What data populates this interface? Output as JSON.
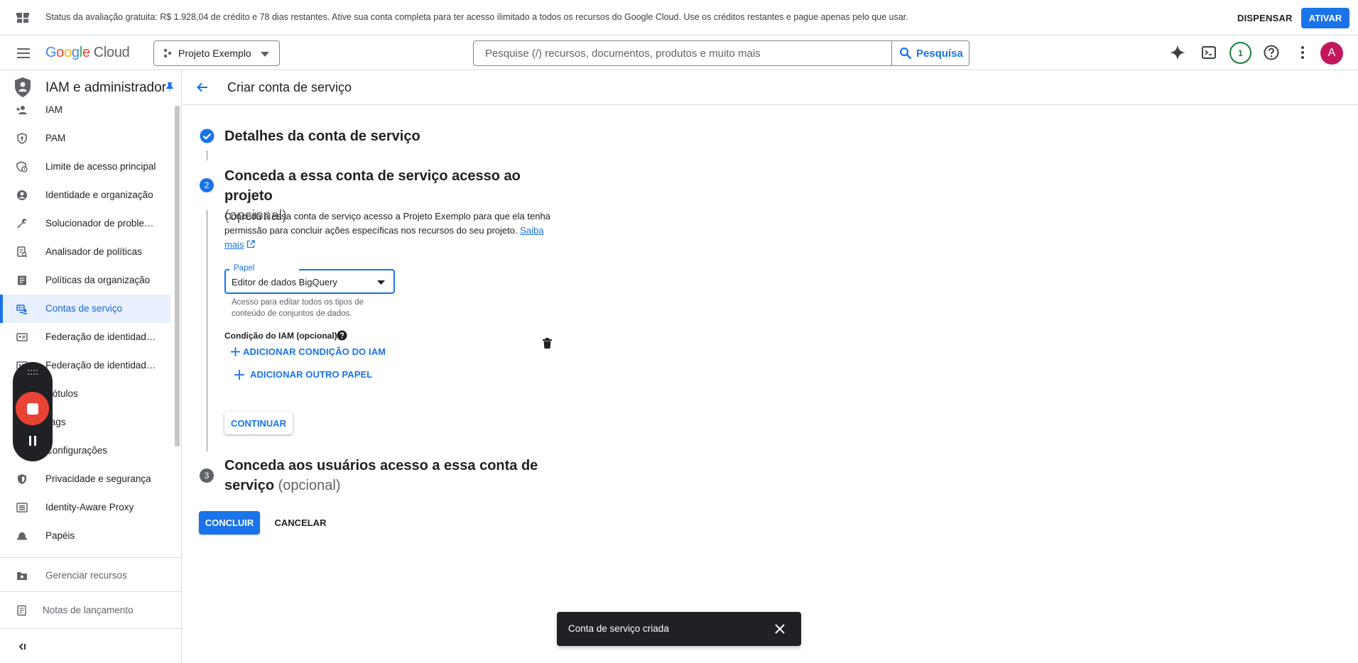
{
  "banner": {
    "message": "Status da avaliação gratuita: R$ 1.928,04 de crédito e 78 dias restantes. Ative sua conta completa para ter acesso ilimitado a todos os recursos do Google Cloud. Use os créditos restantes e pague apenas pelo que usar.",
    "dismiss_label": "DISPENSAR",
    "activate_label": "ATIVAR"
  },
  "header": {
    "logo_google": [
      "G",
      "o",
      "o",
      "g",
      "l",
      "e"
    ],
    "logo_cloud": "Cloud",
    "project_name": "Projeto Exemplo",
    "search_placeholder": "Pesquise (/) recursos, documentos, produtos e muito mais",
    "search_button_label": "Pesquisa",
    "notifications_count": "1",
    "avatar_initial": "A"
  },
  "sidebar": {
    "title": "IAM e administrador",
    "items": [
      {
        "label": "IAM",
        "icon": "person-add-icon",
        "active": false
      },
      {
        "label": "PAM",
        "icon": "shield-key-icon",
        "active": false
      },
      {
        "label": "Limite de acesso principal",
        "icon": "shield-clock-icon",
        "active": false
      },
      {
        "label": "Identidade e organização",
        "icon": "account-circle-icon",
        "active": false
      },
      {
        "label": "Solucionador de problemas de políticas",
        "icon": "wrench-icon",
        "active": false
      },
      {
        "label": "Analisador de políticas",
        "icon": "policy-analyzer-icon",
        "active": false
      },
      {
        "label": "Políticas da organização",
        "icon": "document-icon",
        "active": false
      },
      {
        "label": "Contas de serviço",
        "icon": "service-account-icon",
        "active": true
      },
      {
        "label": "Federação de identidade da carga de trabalho",
        "icon": "id-card-icon",
        "active": false
      },
      {
        "label": "Federação de identidade da força de trabalho",
        "icon": "id-card-icon",
        "active": false
      },
      {
        "label": "Rótulos",
        "icon": "label-icon",
        "active": false
      },
      {
        "label": "Tags",
        "icon": "tag-icon",
        "active": false
      },
      {
        "label": "Configurações",
        "icon": "gear-icon",
        "active": false
      },
      {
        "label": "Privacidade e segurança",
        "icon": "shield-icon",
        "active": false
      },
      {
        "label": "Identity-Aware Proxy",
        "icon": "proxy-icon",
        "active": false
      },
      {
        "label": "Papéis",
        "icon": "hat-icon",
        "active": false
      }
    ],
    "manage_resources_label": "Gerenciar recursos",
    "release_notes_label": "Notas de lançamento"
  },
  "page": {
    "title": "Criar conta de serviço",
    "step1": {
      "title": "Detalhes da conta de serviço"
    },
    "step2": {
      "number": "2",
      "title": "Conceda a essa conta de serviço acesso ao projeto",
      "optional": "(opcional)",
      "description": "Conceda a essa conta de serviço acesso a Projeto Exemplo para que ela tenha permissão para concluir ações específicas nos recursos do seu projeto.",
      "learn_more": "Saiba mais",
      "role_label": "Papel",
      "role_value": "Editor de dados BigQuery",
      "role_hint": "Acesso para editar todos os tipos de conteúdo de conjuntos de dados.",
      "condition_label": "Condição do IAM (opcional)",
      "add_condition_label": "ADICIONAR CONDIÇÃO DO IAM",
      "add_role_label": "ADICIONAR OUTRO PAPEL",
      "continue_label": "CONTINUAR"
    },
    "step3": {
      "number": "3",
      "title_line1": "Conceda aos usuários acesso a essa conta de",
      "title_line2": "serviço",
      "optional": "(opcional)"
    },
    "finish_label": "CONCLUIR",
    "cancel_label": "CANCELAR"
  },
  "snackbar": {
    "message": "Conta de serviço criada"
  },
  "colors": {
    "accent": "#1a73e8",
    "active_bg": "#e8f0fe",
    "step_done": "#1a73e8",
    "step_pending": "#5f6368",
    "avatar": "#c2185b",
    "record_stop": "#ea4335"
  }
}
